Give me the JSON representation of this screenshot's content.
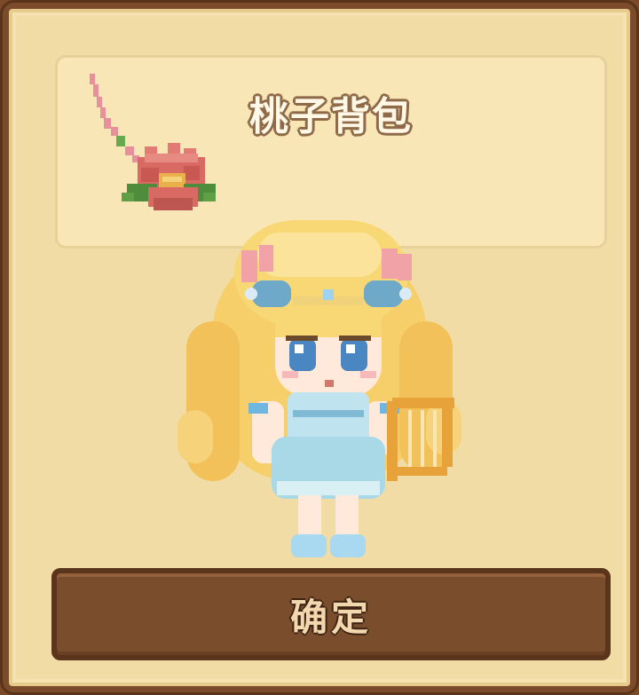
{
  "dialog": {
    "title": "桃子背包",
    "confirm_label": "确定",
    "item_icon": "peach-flower-bag-icon",
    "character": "pixel-girl-with-harp"
  },
  "colors": {
    "frame": "#7b4b2c",
    "panel": "#f1dca6",
    "card": "#f8e6b6",
    "button": "#7a4d2d",
    "button_text": "#f3d7ae",
    "title_text": "#fff8e6"
  }
}
